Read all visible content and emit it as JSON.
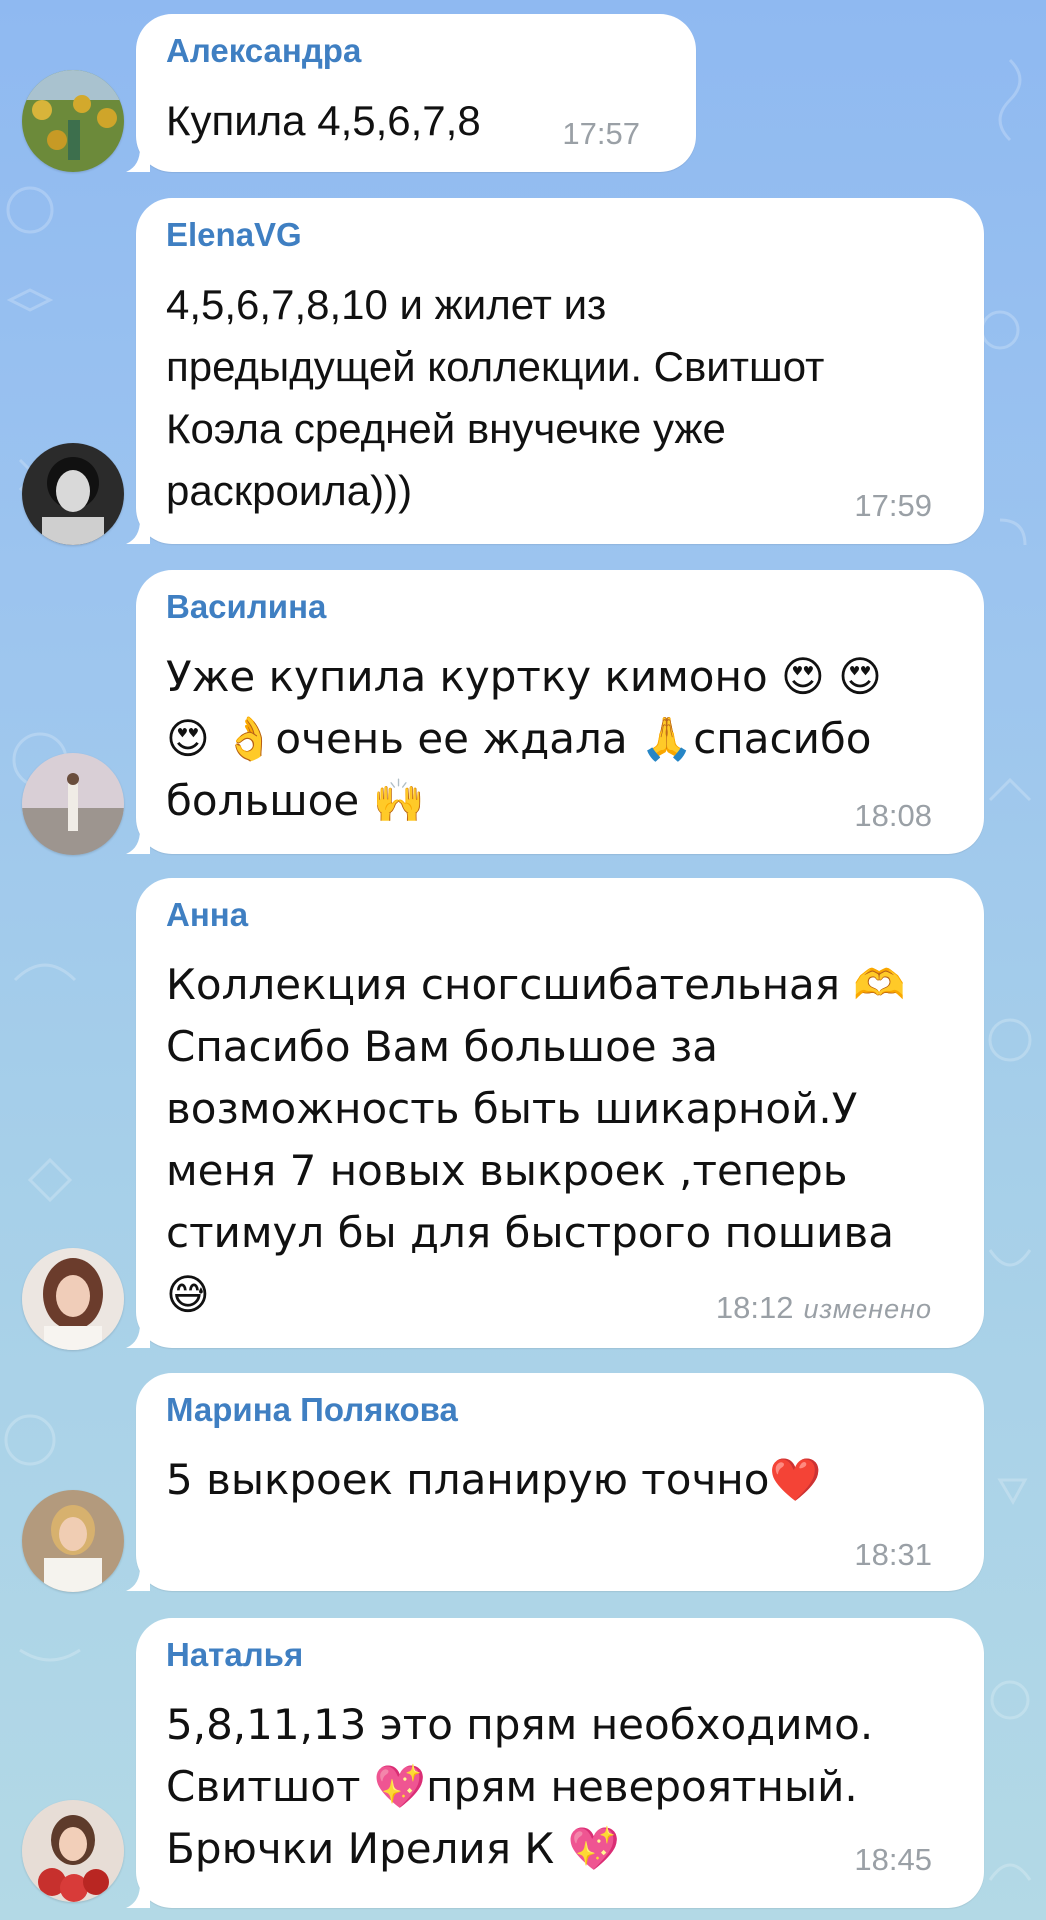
{
  "messages": [
    {
      "sender": "Александра",
      "text": "Купила 4,5,6,7,8",
      "time": "17:57",
      "avatar_icon": "avatar-photo-sunflowers"
    },
    {
      "sender": "ElenaVG",
      "text": "4,5,6,7,8,10 и жилет из\nпредыдущей коллекции. Свитшот\nКоэла средней внучечке уже\nраскроила)))",
      "time": "17:59",
      "avatar_icon": "avatar-photo-portrait-bw"
    },
    {
      "sender": "Василина",
      "text": "Уже купила куртку кимоно 😍 😍\n😍 👌очень ее ждала 🙏спасибо\nбольшое 🙌",
      "time": "18:08",
      "avatar_icon": "avatar-photo-beach"
    },
    {
      "sender": "Анна",
      "text": "Коллекция сногсшибательная 🫶\nСпасибо Вам большое за\nвозможность быть шикарной.У\nменя 7 новых выкроек ,теперь\nстимул бы для быстрого пошива\n😅",
      "time": "18:12",
      "edited": "изменено",
      "avatar_icon": "avatar-photo-woman-portrait"
    },
    {
      "sender": "Марина Полякова",
      "text": "5 выкроек планирую точно❤️",
      "time": "18:31",
      "avatar_icon": "avatar-photo-woman-white"
    },
    {
      "sender": "Наталья",
      "text": "5,8,11,13 это прям необходимо.\nСвитшот 💖прям невероятный.\nБрючки Ирелия К 💖",
      "time": "18:45",
      "avatar_icon": "avatar-photo-woman-flowers"
    }
  ],
  "colors": {
    "sender": "#3f7fc2",
    "bubble": "#ffffff",
    "time": "#9aa0a6",
    "bg_top": "#8fb9f1",
    "bg_bottom": "#b3d9e6"
  }
}
